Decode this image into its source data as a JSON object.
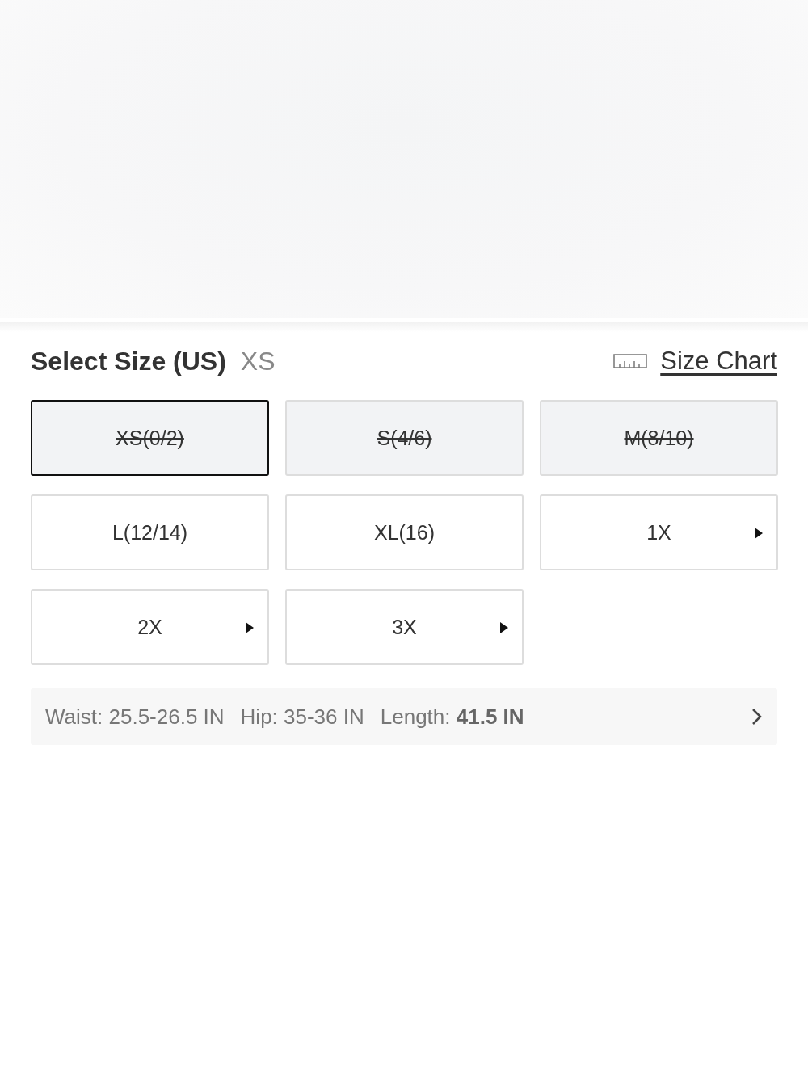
{
  "header": {
    "title": "Select Size (US)",
    "selected_size": "XS",
    "size_chart_link": "Size Chart"
  },
  "sizes": [
    {
      "label": "XS(0/2)",
      "selected": true,
      "unavailable": true,
      "arrow": false
    },
    {
      "label": "S(4/6)",
      "selected": false,
      "unavailable": true,
      "arrow": false
    },
    {
      "label": "M(8/10)",
      "selected": false,
      "unavailable": true,
      "arrow": false
    },
    {
      "label": "L(12/14)",
      "selected": false,
      "unavailable": false,
      "arrow": false
    },
    {
      "label": "XL(16)",
      "selected": false,
      "unavailable": false,
      "arrow": false
    },
    {
      "label": "1X",
      "selected": false,
      "unavailable": false,
      "arrow": true
    },
    {
      "label": "2X",
      "selected": false,
      "unavailable": false,
      "arrow": true
    },
    {
      "label": "3X",
      "selected": false,
      "unavailable": false,
      "arrow": true
    }
  ],
  "measurements": [
    "Waist: 25.5-26.5 IN",
    "Hip: 35-36 IN",
    "Length: **41.5 IN**"
  ]
}
